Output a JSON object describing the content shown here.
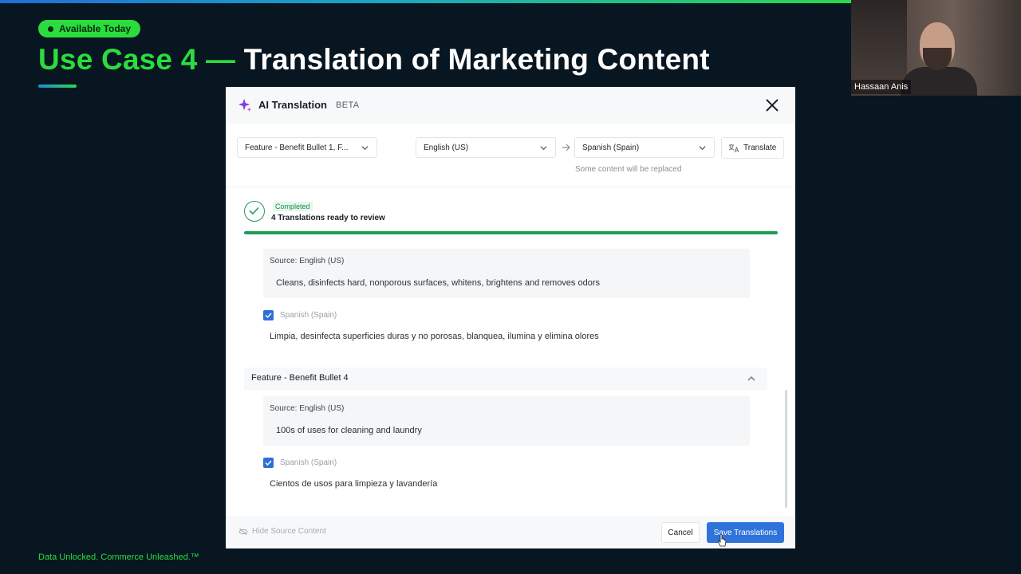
{
  "slide": {
    "badge": "Available Today",
    "title_accent": "Use Case 4 —",
    "title_rest": " Translation of Marketing Content",
    "footer": "Data Unlocked. Commerce Unleashed.™"
  },
  "webcam": {
    "name": "Hassaan Anis"
  },
  "modal": {
    "title": "AI Translation",
    "badge": "BETA",
    "field_select": "Feature - Benefit Bullet 1, F...",
    "source_language": "English (US)",
    "target_language": "Spanish (Spain)",
    "translate_label": "Translate",
    "hint": "Some content will be replaced",
    "status": {
      "label": "Completed",
      "text": "4 Translations ready to review",
      "progress_percent": 100
    },
    "entries": [
      {
        "source_label": "Source: English (US)",
        "source_text": "Cleans, disinfects hard, nonporous surfaces, whitens, brightens and removes odors",
        "target_label": "Spanish (Spain)",
        "target_text": "Limpia, desinfecta superficies duras y no porosas, blanquea, ilumina y elimina olores"
      }
    ],
    "section": {
      "title": "Feature - Benefit Bullet 4",
      "source_label": "Source: English (US)",
      "source_text": "100s of uses for cleaning and laundry",
      "target_label": "Spanish (Spain)",
      "target_text": "Cientos de usos para limpieza y lavandería"
    },
    "footer": {
      "hide_source": "Hide Source Content",
      "cancel": "Cancel",
      "save": "Save Translations"
    }
  },
  "colors": {
    "accent_green": "#2bdc3e",
    "background": "#081621",
    "primary_blue": "#2f73da",
    "success_green": "#1f9d55"
  }
}
